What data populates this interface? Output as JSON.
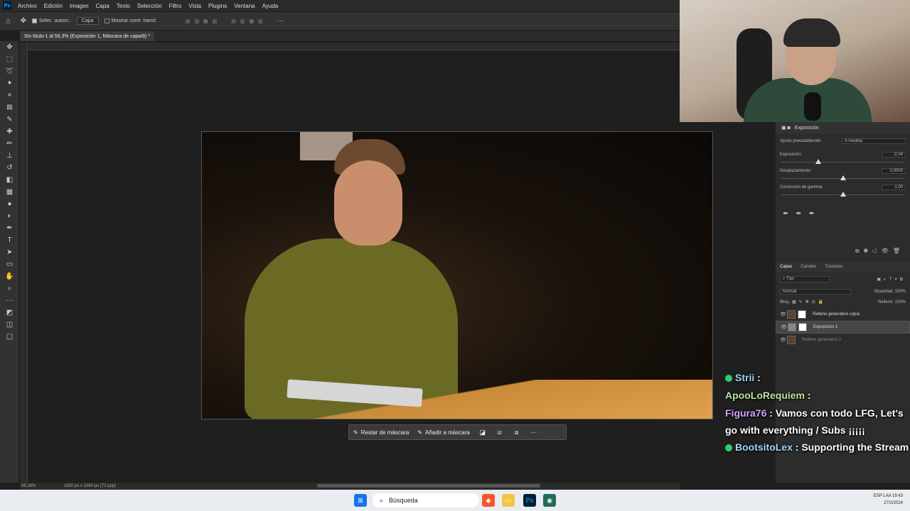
{
  "menu": {
    "logo": "Ps",
    "items": [
      "Archivo",
      "Edición",
      "Imagen",
      "Capa",
      "Texto",
      "Selección",
      "Filtro",
      "Vista",
      "Plugins",
      "Ventana",
      "Ayuda"
    ]
  },
  "options": {
    "autoselect_label": "Selec. autom.:",
    "autoselect_value": "Capa",
    "show_transform_label": "Mostrar contr. transf.",
    "more": "···"
  },
  "document": {
    "tab_title": "Sin título-1 al 56,3% (Exposición 1, Máscara de capa/8) *",
    "close": "×"
  },
  "context_bar": {
    "restrict_label": "Restar de máscara",
    "add_label": "Añadir a máscara",
    "more": "···"
  },
  "status": {
    "zoom": "56,26%",
    "size": "1920 px x 1080 px (72 ppp)"
  },
  "properties": {
    "title": "Exposición",
    "preset_label": "Ajuste preestablecido:",
    "preset_value": "A medida",
    "exposure_label": "Exposición:",
    "exposure_value": "-2,04",
    "exposure_pos": 0.3,
    "offset_label": "Desplazamiento:",
    "offset_value": "0,0000",
    "offset_pos": 0.5,
    "gamma_label": "Corrección de gamma:",
    "gamma_value": "1,00",
    "gamma_pos": 0.5
  },
  "layers_panel": {
    "tabs": [
      "Capas",
      "Canales",
      "Trazados"
    ],
    "filter": "Tipo",
    "blend_mode": "Normal",
    "opacity_label": "Opacidad:",
    "opacity_value": "100%",
    "lock_label": "Bloq.:",
    "fill_label": "Relleno:",
    "fill_value": "100%",
    "layers": [
      {
        "name": "Relleno generativo copia",
        "selected": false
      },
      {
        "name": "Exposición 1",
        "selected": true
      },
      {
        "name": "Relleno generativo 2",
        "selected": false
      }
    ]
  },
  "chat": [
    {
      "user": "Strii",
      "text": ""
    },
    {
      "user": "ApooLoRequiem",
      "text": ""
    },
    {
      "user": "Figura76",
      "text": "Vamos con todo LFG, Let's go with everything / Subs ¡¡¡¡¡"
    },
    {
      "user": "BootsitoLex",
      "text": "Supporting the Stream"
    }
  ],
  "taskbar": {
    "search_placeholder": "Búsqueda",
    "lang": "ESP LAA",
    "time": "19:43",
    "date": "27/2/2024"
  }
}
